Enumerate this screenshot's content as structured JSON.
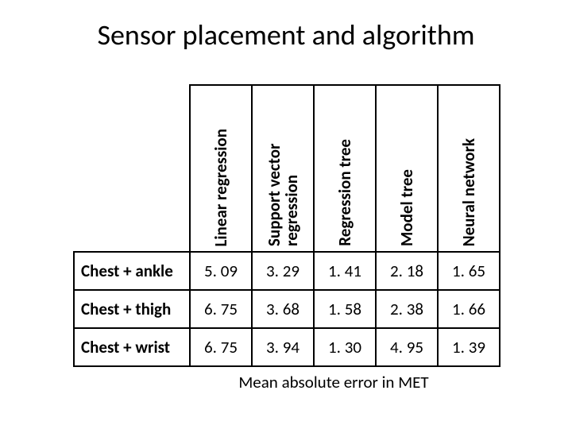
{
  "title": "Sensor placement and algorithm",
  "caption": "Mean absolute error in MET",
  "chart_data": {
    "type": "table",
    "columns": [
      "Linear regression",
      "Support vector regression",
      "Regression tree",
      "Model tree",
      "Neural network"
    ],
    "rows": [
      {
        "label": "Chest + ankle",
        "values": [
          "5. 09",
          "3. 29",
          "1. 41",
          "2. 18",
          "1. 65"
        ]
      },
      {
        "label": "Chest + thigh",
        "values": [
          "6. 75",
          "3. 68",
          "1. 58",
          "2. 38",
          "1. 66"
        ]
      },
      {
        "label": "Chest + wrist",
        "values": [
          "6. 75",
          "3. 94",
          "1. 30",
          "4. 95",
          "1. 39"
        ]
      }
    ]
  }
}
